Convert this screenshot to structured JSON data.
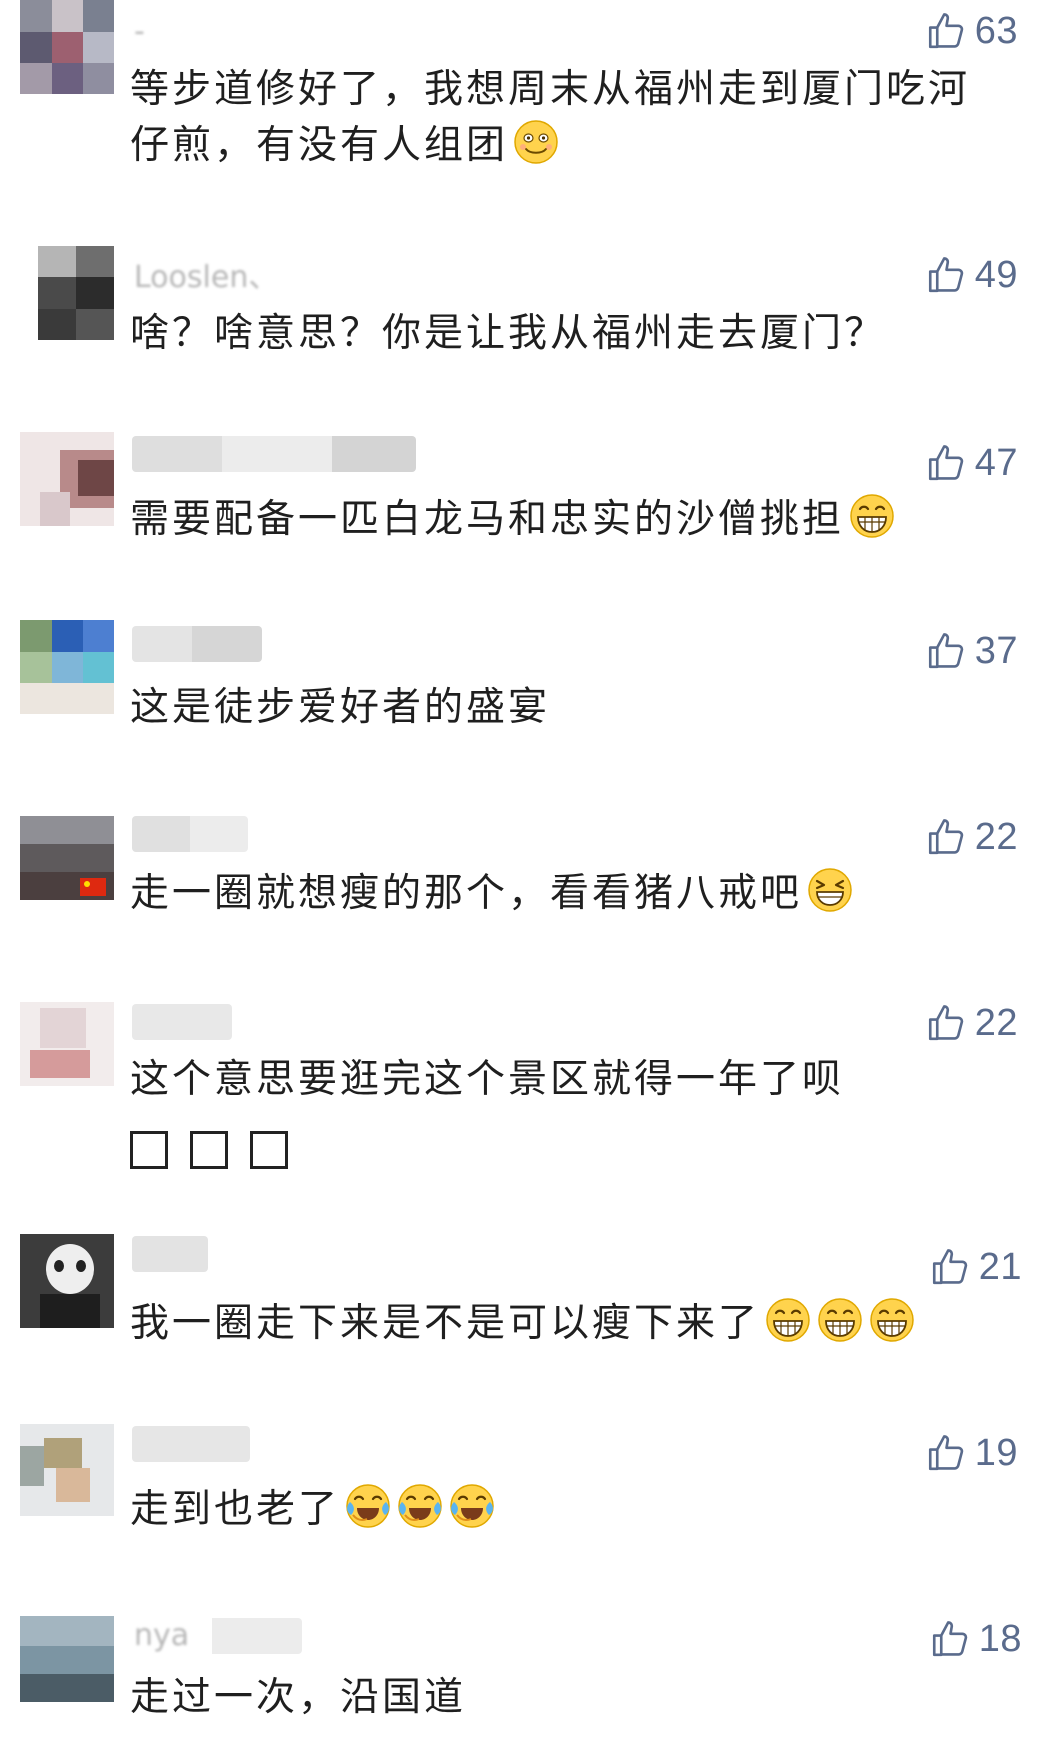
{
  "comments": [
    {
      "username": "-",
      "text": "等步道修好了，我想周末从福州走到厦门吃河仔煎，有没有人组团",
      "likes": "63",
      "emoji": [
        "smile-emoji"
      ]
    },
    {
      "username": "Looslen、",
      "text": "啥？啥意思？你是让我从福州走去厦门？",
      "likes": "49",
      "emoji": []
    },
    {
      "username": "",
      "text": "需要配备一匹白龙马和忠实的沙僧挑担",
      "likes": "47",
      "emoji": [
        "grin-emoji"
      ]
    },
    {
      "username": "",
      "text": "这是徒步爱好者的盛宴",
      "likes": "37",
      "emoji": []
    },
    {
      "username": "",
      "text": "走一圈就想瘦的那个，看看猪八戒吧",
      "likes": "22",
      "emoji": [
        "squint-grin-emoji"
      ]
    },
    {
      "username": "",
      "text": "这个意思要逛完这个景区就得一年了呗",
      "likes": "22",
      "emoji": []
    },
    {
      "username": "",
      "text": "我一圈走下来是不是可以瘦下来了",
      "likes": "21",
      "emoji": [
        "grin-emoji",
        "grin-emoji",
        "grin-emoji"
      ]
    },
    {
      "username": "",
      "text": "走到也老了",
      "likes": "19",
      "emoji": [
        "crying-laugh-emoji",
        "crying-laugh-emoji",
        "crying-laugh-emoji"
      ]
    },
    {
      "username": "nya",
      "text": "走过一次，沿国道",
      "likes": "18",
      "emoji": []
    }
  ],
  "colors": {
    "like_color": "#5a6b8c",
    "text_color": "#1f1f1f",
    "username_color": "#aaaaaa"
  }
}
